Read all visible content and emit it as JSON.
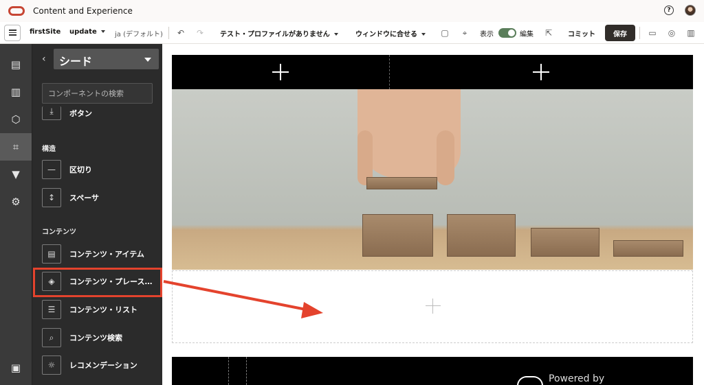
{
  "header": {
    "title": "Content and Experience",
    "help_icon": "help-circle-icon",
    "help_glyph": "?",
    "avatar_icon": "user-avatar-icon"
  },
  "toolbar": {
    "site": "firstSite",
    "update": "update",
    "language": "ja (デフォルト)",
    "profile": "テスト・プロファイルがありません",
    "fit": "ウィンドウに合せる",
    "view_label": "表示",
    "edit_label": "編集",
    "commit_label": "コミット",
    "save_label": "保存",
    "undo_glyph": "↶",
    "redo_glyph": "↷",
    "device_glyph": "▢",
    "ruler_glyph": "⌖",
    "export_glyph": "⇱",
    "comment_glyph": "▭",
    "pin_glyph": "◎",
    "sidebar_glyph": "▥"
  },
  "nav": {
    "items": [
      {
        "icon": "pages-icon",
        "glyph": "▤"
      },
      {
        "icon": "layout-icon",
        "glyph": "▥"
      },
      {
        "icon": "cube-icon",
        "glyph": "⬡"
      },
      {
        "icon": "crop-icon",
        "glyph": "⌗",
        "active": true
      },
      {
        "icon": "theme-icon",
        "glyph": "▼"
      },
      {
        "icon": "settings-icon",
        "glyph": "⚙"
      }
    ],
    "bottom": {
      "icon": "documents-icon",
      "glyph": "▣"
    }
  },
  "panel": {
    "back_glyph": "‹",
    "category": "シード",
    "search_placeholder": "コンポーネントの検索",
    "button_item": "ボタン",
    "structure_heading": "構造",
    "structure_items": [
      {
        "label": "区切り",
        "icon": "divider-icon",
        "glyph": "—"
      },
      {
        "label": "スペーサ",
        "icon": "spacer-icon",
        "glyph": "↕"
      }
    ],
    "content_heading": "コンテンツ",
    "content_items": [
      {
        "label": "コンテンツ・アイテム",
        "icon": "content-item-icon",
        "glyph": "▤"
      },
      {
        "label": "コンテンツ・プレース…",
        "icon": "content-placeholder-icon",
        "glyph": "◈"
      },
      {
        "label": "コンテンツ・リスト",
        "icon": "content-list-icon",
        "glyph": "☰"
      },
      {
        "label": "コンテンツ検索",
        "icon": "content-search-icon",
        "glyph": "⌕"
      },
      {
        "label": "レコメンデーション",
        "icon": "lightbulb-icon",
        "glyph": "☼"
      }
    ]
  },
  "canvas": {
    "footer_text": "Powered by"
  },
  "colors": {
    "accent": "#c74634",
    "highlight": "#e4432d",
    "toggle_on": "#5a7e5a",
    "save_bg": "#312d2a"
  }
}
